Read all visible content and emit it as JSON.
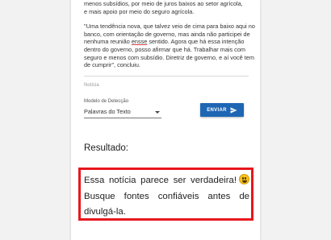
{
  "article": {
    "line1": "menos subsídios, por meio de juros baixos ao setor agrícola,",
    "line2": "e mais apoio por meio do seguro agrícola.",
    "quote_before": "\"Uma tendência nova, que talvez veio de cima para baixo aqui no banco, com orientação de governo, mas ainda não participei de nenhuma reunião ",
    "quote_underlined": "ensse",
    "quote_after": " sentido. Agora que há essa intenção dentro do governo, posso afirmar que há. Trabalhar mais com seguro e menos com subsídio. Diretriz de governo, e aí você tem de cumprir\", concluiu."
  },
  "form": {
    "noticia_label": "Notícia",
    "modelo_label": "Modelo de Detecção",
    "modelo_value": "Palavras do Texto",
    "send_label": "ENVIAR"
  },
  "result": {
    "heading": "Resultado:",
    "line1": "Essa notícia parece ser verdadeira!",
    "line2": "Busque fontes confiáveis antes de divulgá-la.",
    "emoji": "grinning-face-emoji"
  },
  "colors": {
    "accent": "#1e66b4",
    "highlight_border": "#e8171c",
    "background": "#f2f2f2"
  }
}
